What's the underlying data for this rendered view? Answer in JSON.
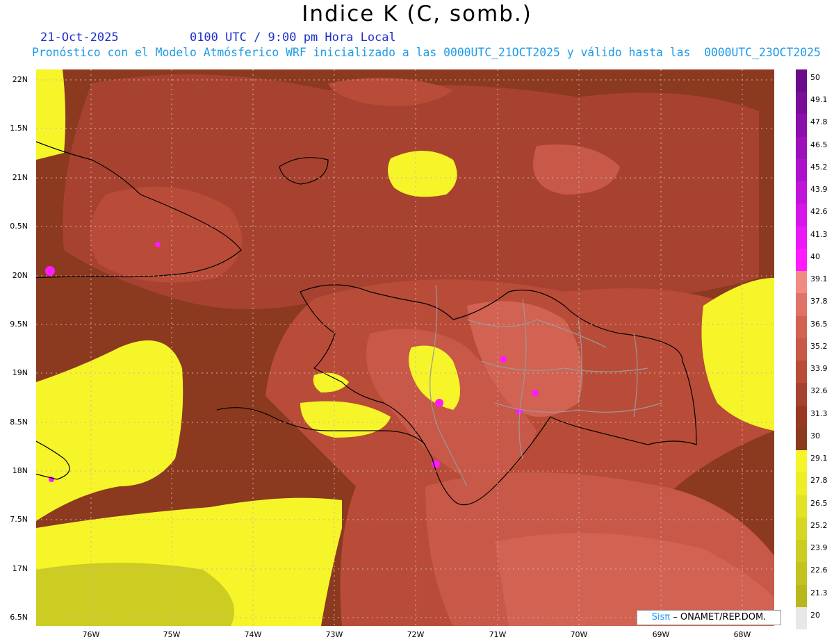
{
  "title": "Indice K (C, somb.)",
  "date": "21-Oct-2025",
  "time": "0100 UTC / 9:00 pm Hora Local",
  "subtitle": "Pronóstico con el Modelo Atmósferico WRF inicializado a las 0000UTC_21OCT2025 y válido hasta las  0000UTC_23OCT2025",
  "lat_labels": [
    "22N",
    "1.5N",
    "21N",
    "0.5N",
    "20N",
    "9.5N",
    "19N",
    "8.5N",
    "18N",
    "7.5N",
    "17N",
    "6.5N"
  ],
  "lon_labels": [
    "76W",
    "75W",
    "74W",
    "73W",
    "72W",
    "71W",
    "70W",
    "69W",
    "68W"
  ],
  "legend_values": [
    "50",
    "49.1",
    "47.8",
    "46.5",
    "45.2",
    "43.9",
    "42.6",
    "41.3",
    "40",
    "39.1",
    "37.8",
    "36.5",
    "35.2",
    "33.9",
    "32.6",
    "31.3",
    "30",
    "29.1",
    "27.8",
    "26.5",
    "25.2",
    "23.9",
    "22.6",
    "21.3",
    "20"
  ],
  "legend_colors": [
    "#6a0a8a",
    "#7a0c9a",
    "#8b0eaa",
    "#9c10ba",
    "#ad12ca",
    "#c014da",
    "#d516e8",
    "#ea18f4",
    "#ff1aff",
    "#f08a82",
    "#e07268",
    "#d26252",
    "#c85848",
    "#b84c38",
    "#a84230",
    "#983822",
    "#8b3a1f",
    "#f5f52a",
    "#eded28",
    "#e2e226",
    "#d6d624",
    "#cccc22",
    "#c2c220",
    "#b8b81e",
    "#e8e8e8"
  ],
  "credit_brand": "Sisπ",
  "credit_text": "– ONAMET/REP.DOM.",
  "colors": {
    "title_date": "#1e2fd0",
    "subtitle": "#1e9be8",
    "background_field": "#8b3a1f",
    "low_field": "#f5f52a",
    "coast": "#000000",
    "provinces": "#999999"
  }
}
